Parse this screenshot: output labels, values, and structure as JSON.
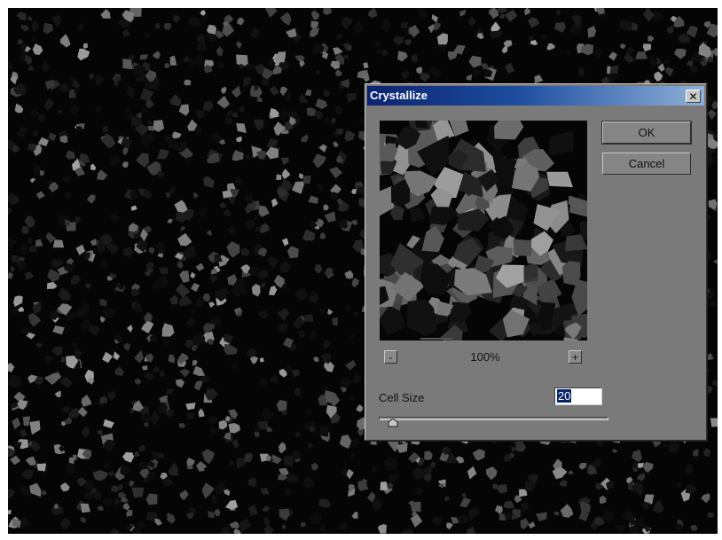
{
  "dialog": {
    "title": "Crystallize",
    "close_icon": "close-icon",
    "ok_label": "OK",
    "cancel_label": "Cancel",
    "zoom_out_label": "-",
    "zoom_in_label": "+",
    "zoom_level": "100%",
    "cell_size_label": "Cell Size",
    "cell_size_value": "20",
    "cell_size_slider_fraction": 0.06
  },
  "colors": {
    "canvas_background": "#050505",
    "dialog_background": "#7a7a7a",
    "titlebar_start": "#0a2470",
    "titlebar_end": "#8fb0d8",
    "selection": "#0a246a"
  }
}
